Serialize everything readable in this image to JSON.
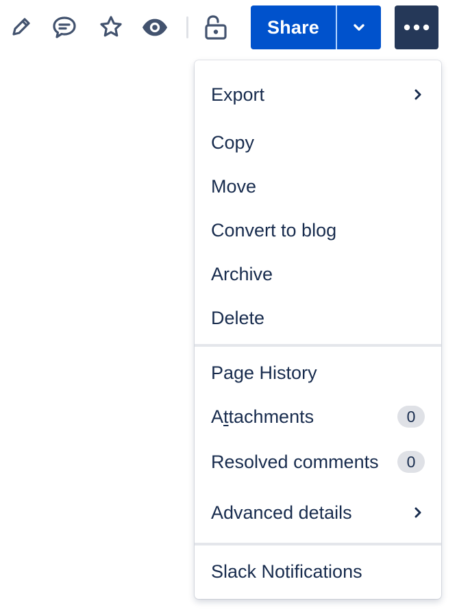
{
  "toolbar": {
    "icons": [
      "pencil-icon",
      "comment-icon",
      "star-icon",
      "eye-icon",
      "unlock-icon"
    ],
    "share_label": "Share",
    "share_caret_icon": "chevron-down-icon",
    "more_icon": "ellipsis-icon"
  },
  "menu": {
    "group1": [
      {
        "label": "Export",
        "submenu": true
      },
      {
        "label": "Copy"
      },
      {
        "label": "Move"
      },
      {
        "label": "Convert to blog"
      },
      {
        "label": "Archive"
      },
      {
        "label": "Delete"
      }
    ],
    "group2": [
      {
        "label": "Page History"
      },
      {
        "label_pre": "A",
        "label_ul": "t",
        "label_post": "tachments",
        "count": "0"
      },
      {
        "label": "Resolved comments",
        "count": "0"
      },
      {
        "label": "Advanced details",
        "submenu": true
      }
    ],
    "group3": [
      {
        "label": "Slack Notifications"
      }
    ]
  },
  "colors": {
    "primary": "#0052cc",
    "more_button": "#253858",
    "text": "#172b4d",
    "icon": "#42526e",
    "badge_bg": "#dfe1e6"
  }
}
